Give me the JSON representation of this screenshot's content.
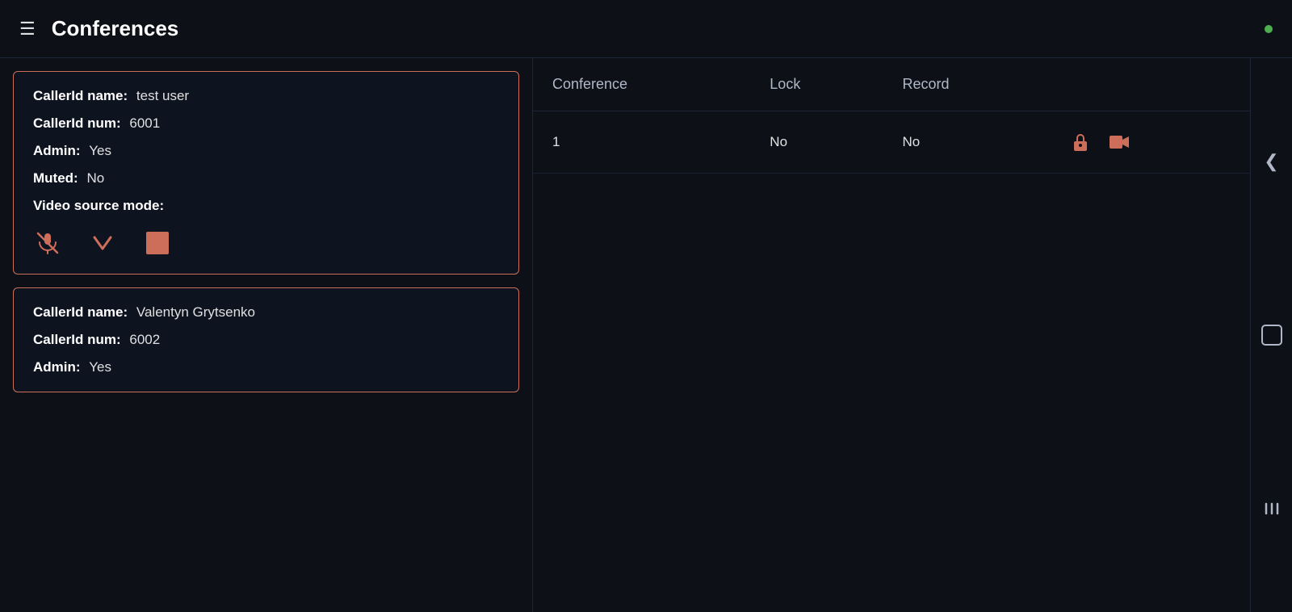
{
  "header": {
    "title": "Conferences",
    "menu_icon": "☰",
    "status_dot_color": "#4caf50"
  },
  "callers": [
    {
      "id": "caller-1",
      "caller_id_name_label": "CallerId name:",
      "caller_id_name_value": "test user",
      "caller_id_num_label": "CallerId num:",
      "caller_id_num_value": "6001",
      "admin_label": "Admin:",
      "admin_value": "Yes",
      "muted_label": "Muted:",
      "muted_value": "No",
      "video_source_label": "Video source mode:"
    },
    {
      "id": "caller-2",
      "caller_id_name_label": "CallerId name:",
      "caller_id_name_value": "Valentyn Grytsenko",
      "caller_id_num_label": "CallerId num:",
      "caller_id_num_value": "6002",
      "admin_label": "Admin:",
      "admin_value": "Yes",
      "muted_label": "",
      "muted_value": "",
      "video_source_label": ""
    }
  ],
  "table": {
    "columns": [
      "Conference",
      "Lock",
      "Record"
    ],
    "rows": [
      {
        "conference": "1",
        "lock": "No",
        "record": "No"
      }
    ]
  },
  "nav_icons": {
    "back_chevron": "❮",
    "circle_icon": "○",
    "bars_icon": "|||"
  }
}
